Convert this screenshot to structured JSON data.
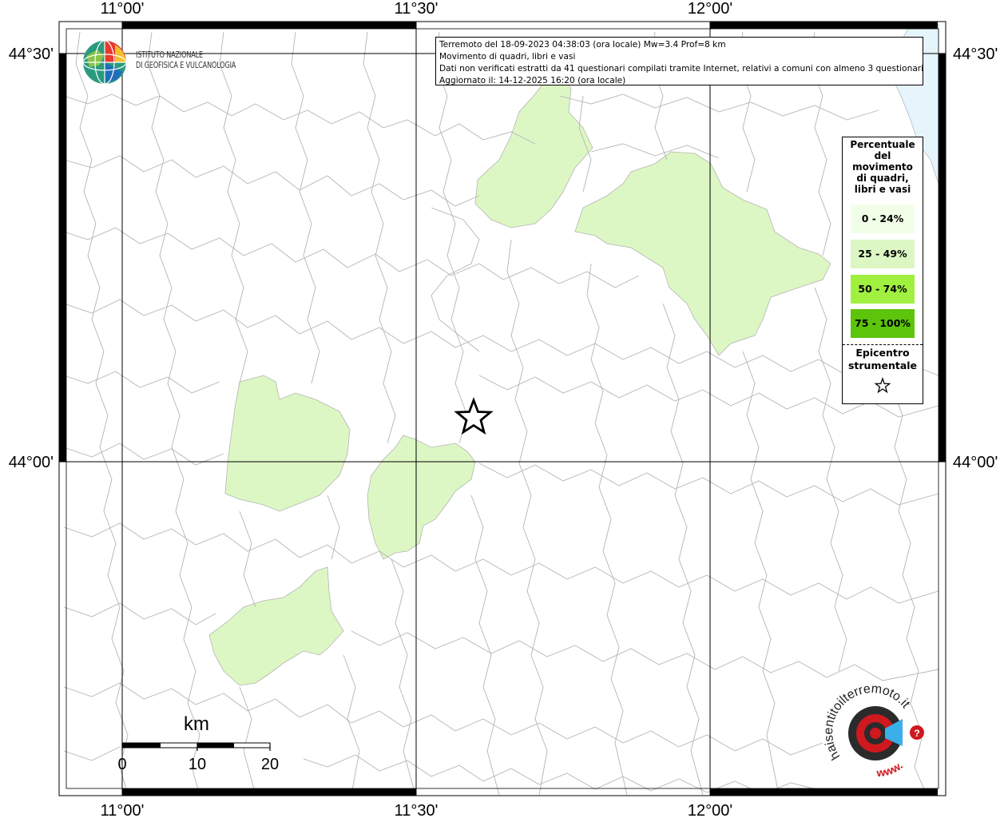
{
  "info": {
    "line1": "Terremoto del 18-09-2023 04:38:03 (ora locale) Mw=3.4 Prof=8 km",
    "line2": "Movimento di quadri, libri e vasi",
    "line3": "Dati non verificati estratti da 41 questionari compilati tramite Internet, relativi a comuni con almeno 3 questionari.",
    "line4": "Aggiornato il: 14-12-2025 16:20 (ora locale)"
  },
  "institute": {
    "name_line1": "ISTITUTO NAZIONALE",
    "name_line2": "DI GEOFISICA E VULCANOLOGIA"
  },
  "legend": {
    "title_lines": [
      "Percentuale",
      "del",
      "movimento",
      "di quadri,",
      "libri e vasi"
    ],
    "items": [
      {
        "label": "0 - 24%",
        "color": "#f2ffe8"
      },
      {
        "label": "25 - 49%",
        "color": "#ddf7c4"
      },
      {
        "label": "50 - 74%",
        "color": "#a0f040"
      },
      {
        "label": "75 - 100%",
        "color": "#5cc40a"
      }
    ],
    "epicenter_line1": "Epicentro",
    "epicenter_line2": "strumentale"
  },
  "coordinates": {
    "lon_labels": [
      "11°00'",
      "11°30'",
      "12°00'"
    ],
    "lat_labels": [
      "44°30'",
      "44°00'"
    ]
  },
  "scale": {
    "unit": "km",
    "ticks": [
      "0",
      "10",
      "20"
    ]
  },
  "brand": {
    "site": "haisentitoilterremoto.it",
    "www": "www."
  },
  "colors": {
    "affected_area": "#ddf7c4",
    "sea": "#e6f4fb",
    "boundaries": "#b4b4b4",
    "grid": "#000000"
  }
}
